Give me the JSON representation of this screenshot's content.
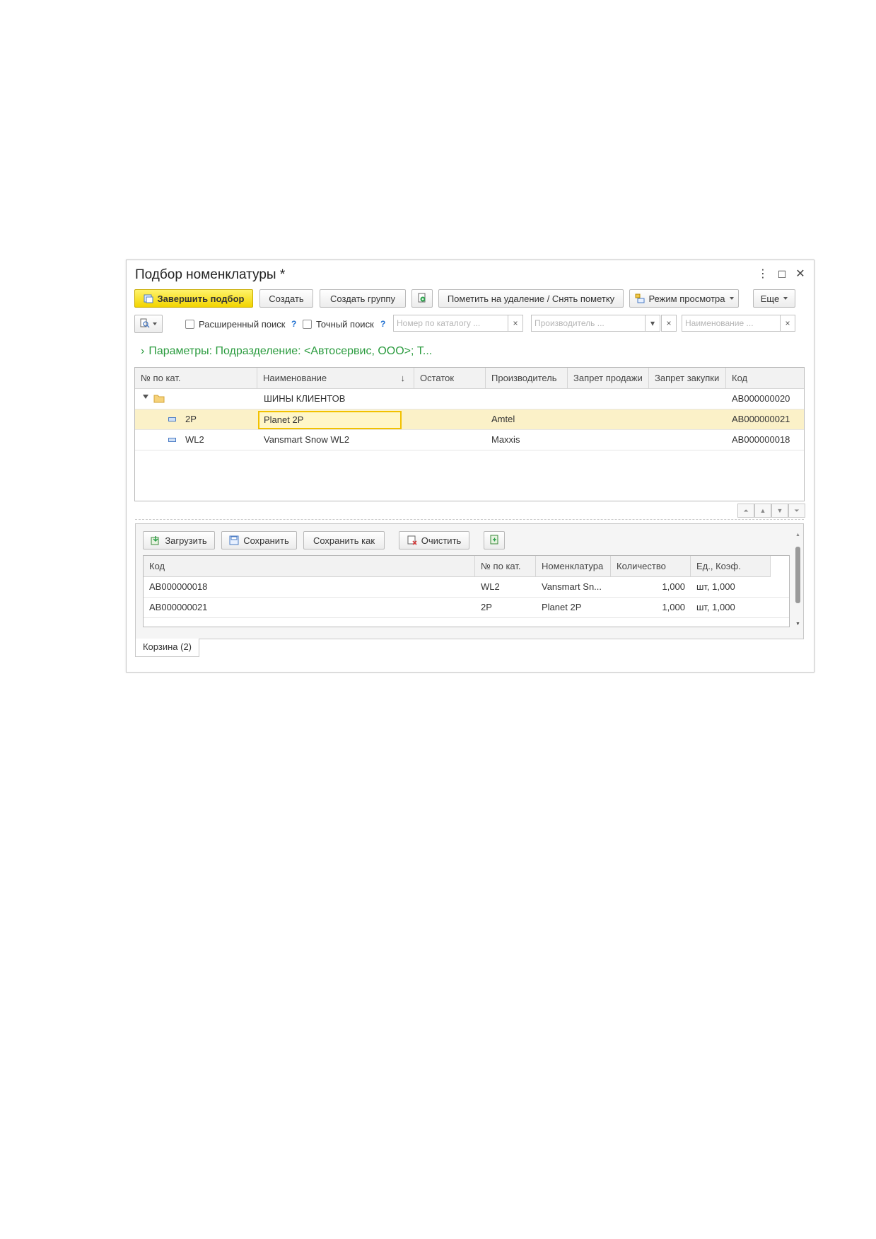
{
  "window": {
    "title": "Подбор номенклатуры *",
    "controls": {
      "menu": "⋮",
      "maximize": "☐",
      "close": "✕"
    }
  },
  "toolbar": {
    "finish": "Завершить подбор",
    "create": "Создать",
    "create_group": "Создать группу",
    "mark_delete": "Пометить на удаление / Снять пометку",
    "view_mode": "Режим просмотра",
    "more": "Еще"
  },
  "search": {
    "advanced_label": "Расширенный поиск",
    "exact_label": "Точный поиск",
    "help": "?",
    "catalog_placeholder": "Номер по каталогу ...",
    "manufacturer_placeholder": "Производитель ...",
    "name_placeholder": "Наименование ...",
    "clear": "×",
    "dropdown": "▾"
  },
  "params": {
    "chevron": "›",
    "text": "Параметры: Подразделение: <Автосервис, ООО>; Т..."
  },
  "main_table": {
    "columns": [
      "№ по кат.",
      "Наименование",
      "Остаток",
      "Производитель",
      "Запрет продажи",
      "Запрет закупки",
      "Код"
    ],
    "sort_arrow": "↓",
    "group": {
      "name": "ШИНЫ КЛИЕНТОВ",
      "code": "АВ000000020"
    },
    "rows": [
      {
        "cat": "2P",
        "name": "Planet 2P",
        "stock": "",
        "maker": "Amtel",
        "no_sale": "",
        "no_buy": "",
        "code": "АВ000000021"
      },
      {
        "cat": "WL2",
        "name": "Vansmart Snow WL2",
        "stock": "",
        "maker": "Maxxis",
        "no_sale": "",
        "no_buy": "",
        "code": "АВ000000018"
      }
    ],
    "selected_row": 0
  },
  "cart": {
    "toolbar": {
      "load": "Загрузить",
      "save": "Сохранить",
      "save_as": "Сохранить как",
      "clear": "Очистить"
    },
    "columns": [
      "Код",
      "№ по кат.",
      "Номенклатура",
      "Количество",
      "Ед., Коэф."
    ],
    "rows": [
      {
        "code": "АВ000000018",
        "cat": "WL2",
        "item": "Vansmart Sn...",
        "qty": "1,000",
        "unit": "шт, 1,000"
      },
      {
        "code": "АВ000000021",
        "cat": "2P",
        "item": "Planet 2P",
        "qty": "1,000",
        "unit": "шт, 1,000"
      }
    ],
    "tab": "Корзина (2)"
  },
  "colors": {
    "accent_yellow": "#f2d400",
    "selected_row": "#fbf1c8",
    "params_green": "#2a9b3e",
    "help_blue": "#1f6fd0"
  }
}
